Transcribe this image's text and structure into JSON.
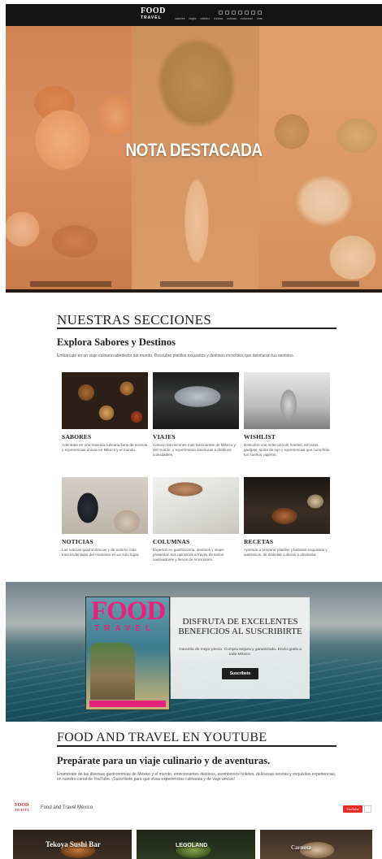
{
  "topnav": {
    "logo_main": "FOOD",
    "logo_sub": "TRAVEL",
    "links": [
      "sabores",
      "viajes",
      "wishlist",
      "recetas",
      "noticias",
      "columnas",
      "más"
    ]
  },
  "hero": {
    "title": "NOTA DESTACADA"
  },
  "sections": {
    "title": "NUESTRAS SECCIONES",
    "subtitle": "Explora Sabores y Destinos",
    "description": "Embárcate en un viaje culinario alrededor del mundo. Descubre platillos exquisitos y destinos increíbles que deleitarán tus sentidos.",
    "cards": [
      {
        "name": "SABORES",
        "text": "Adéntrate en una travesía culinaria llena de aromas y experiencias únicas en México y el mundo."
      },
      {
        "name": "VIAJES",
        "text": "Conoce los rincones más fascinantes de México y del mundo, y experimenta aventuras a destinos inolvidables."
      },
      {
        "name": "WISHLIST",
        "text": "Descubre una selección de hoteles, artículos, gadgets, spots de lujo y experiencias que cumplirán tus sueños viajeros."
      },
      {
        "name": "NOTICIAS",
        "text": "Las noticias gastronómicas y de turismo más trascendentales del momento en un solo lugar."
      },
      {
        "name": "COLUMNAS",
        "text": "Expertos en gastronomía, destinos y viajes presentan sus opiniones a través de textos cautivadores y llenos de emociones."
      },
      {
        "name": "RECETAS",
        "text": "Aprende a preparar platillos y bebidas exquisitos y auténticos, de distintas culturas a alrededor."
      }
    ]
  },
  "subscribe": {
    "title": "DISFRUTA DE EXCELENTES BENEFICIOS AL SUSCRIBIRTE",
    "description": "Garantía de mejor precio. Compra segura y garantizada. Envío gratis a todo México.",
    "button": "Suscríbete",
    "magazine_title": "FOOD",
    "magazine_sub": "TRAVEL"
  },
  "youtube": {
    "title": "FOOD AND TRAVEL EN YOUTUBE",
    "subtitle": "Prepárate para un viaje culinario y de aventuras.",
    "description": "Enamórate de las diversas gastronomías de México y el mundo, emocionantes destinos, asombrosos hoteles, deliciosas recetas y exquisitas experiencias, en nuestro canal de YouTube. ¡Suscríbete para que vivas experiencias culinarias y de viaje únicas!",
    "channel_name": "Food and Travel México",
    "channel_logo": "FOOD",
    "channel_logo_sub": "TRAVEL",
    "yt_button": "YouTube",
    "videos": [
      "Tekoya Sushi Bar",
      "LEGOLAND",
      "Carnota"
    ]
  }
}
